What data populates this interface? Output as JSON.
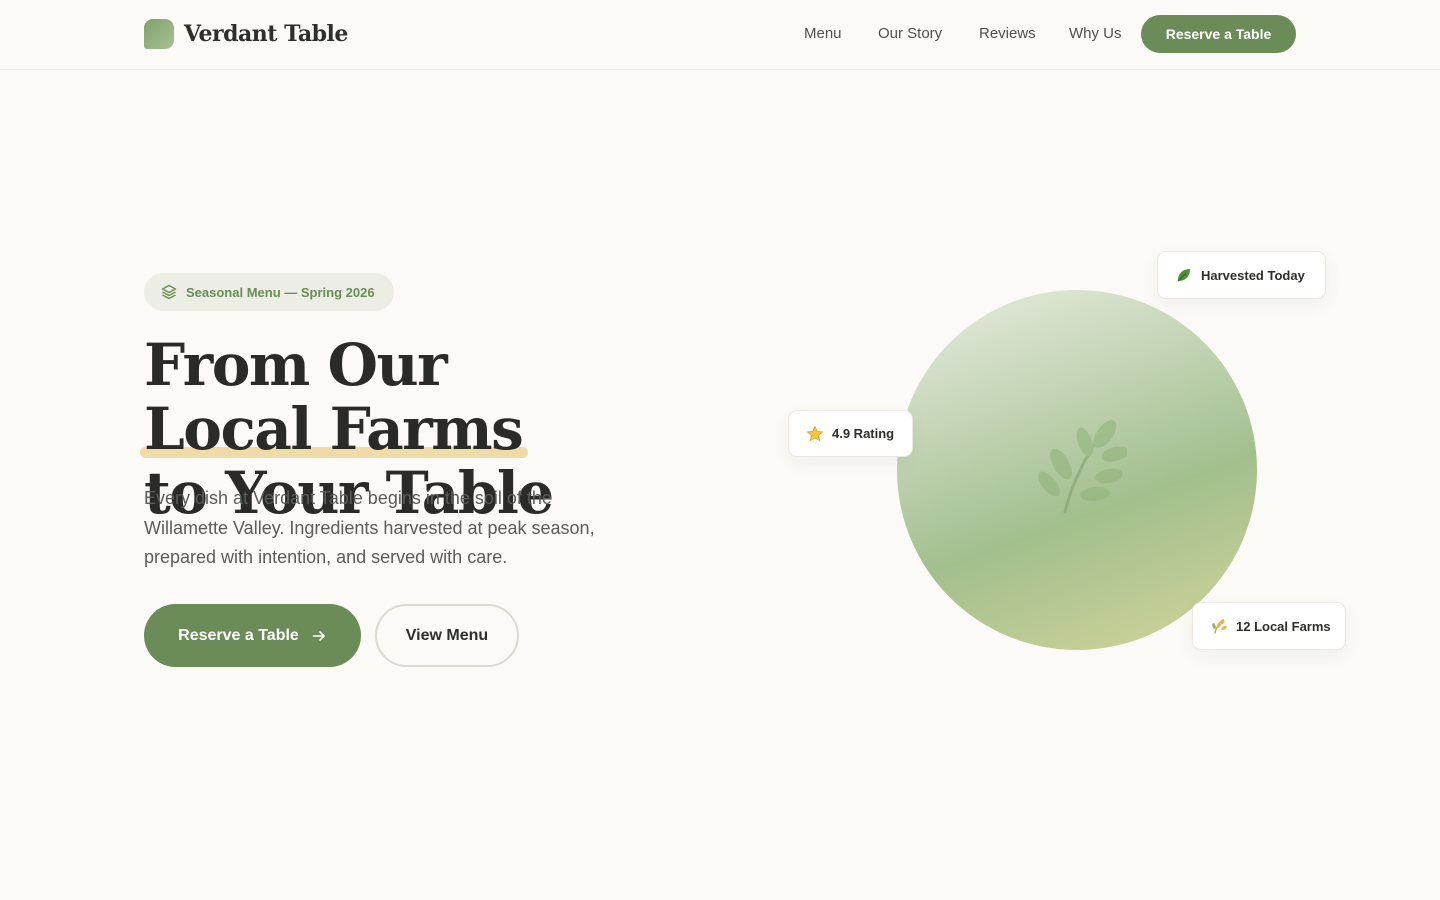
{
  "header": {
    "brand_name": "Verdant Table",
    "nav": [
      "Menu",
      "Our Story",
      "Reviews",
      "Why Us"
    ],
    "cta_label": "Reserve a Table"
  },
  "hero": {
    "badge": "Seasonal Menu — Spring 2026",
    "headline_part1": "From Our ",
    "headline_highlight": "Local Farms",
    "headline_line2": "to Your Table",
    "lede": "Every dish at Verdant Table begins in the soil of the Willamette Valley. Ingredients harvested at peak season, prepared with intention, and served with care.",
    "primary_cta": "Reserve a Table",
    "secondary_cta": "View Menu"
  },
  "chips": {
    "harvested": "Harvested Today",
    "rating": "4.9 Rating",
    "farms": "12 Local Farms"
  },
  "colors": {
    "accent": "#6b8c59",
    "background": "#fbfaf7",
    "highlight": "#efdba8"
  },
  "icons": {
    "badge": "layers-icon",
    "harvested": "leaf-icon",
    "rating": "star-icon",
    "farms": "wheat-icon",
    "cta": "arrow-right-icon"
  }
}
